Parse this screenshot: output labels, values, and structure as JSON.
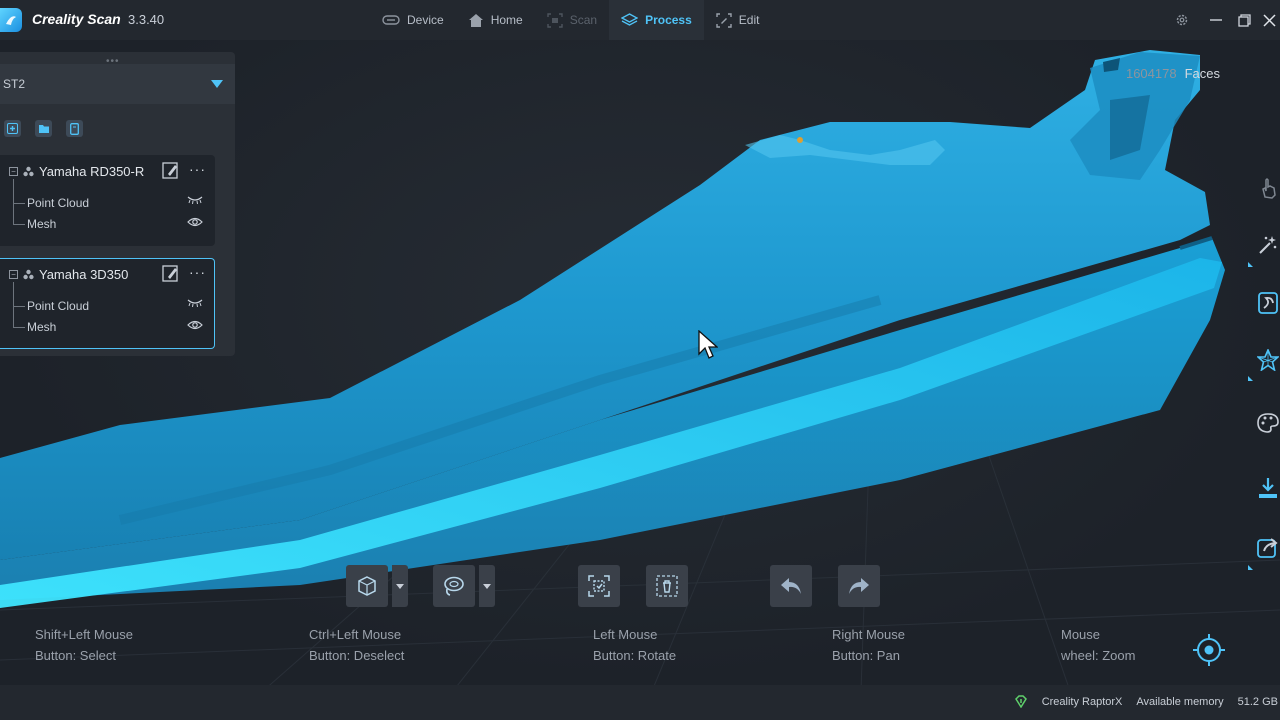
{
  "app": {
    "name": "Creality Scan",
    "version": "3.3.40"
  },
  "nav": [
    {
      "label": "Device",
      "state": "normal",
      "icon": "device-icon"
    },
    {
      "label": "Home",
      "state": "normal",
      "icon": "home-icon"
    },
    {
      "label": "Scan",
      "state": "disabled",
      "icon": "scan-icon"
    },
    {
      "label": "Process",
      "state": "active",
      "icon": "layers-icon"
    },
    {
      "label": "Edit",
      "state": "normal",
      "icon": "edit-icon"
    }
  ],
  "viewport": {
    "faces_count": "1604178",
    "faces_label": "Faces"
  },
  "panel": {
    "device": "ST2",
    "projects": [
      {
        "name": "Yamaha RD350-R",
        "selected": false,
        "children": [
          "Point Cloud",
          "Mesh"
        ],
        "more": "···"
      },
      {
        "name": "Yamaha 3D350",
        "selected": true,
        "children": [
          "Point Cloud",
          "Mesh"
        ],
        "more": "···"
      }
    ]
  },
  "hints": [
    {
      "line1": "Shift+Left Mouse",
      "line2": "Button:  Select"
    },
    {
      "line1": "Ctrl+Left Mouse",
      "line2": "Button:  Deselect"
    },
    {
      "line1": "Left Mouse",
      "line2": "Button:  Rotate"
    },
    {
      "line1": "Right Mouse",
      "line2": "Button:  Pan"
    },
    {
      "line1": "Mouse",
      "line2": "wheel:  Zoom"
    }
  ],
  "status": {
    "gpu": "Creality RaptorX",
    "memory_label": "Available memory",
    "memory_value": "51.2 GB"
  },
  "colors": {
    "accent": "#4fc3f7",
    "mesh": "#1ea3d8",
    "background": "#1d2229"
  }
}
